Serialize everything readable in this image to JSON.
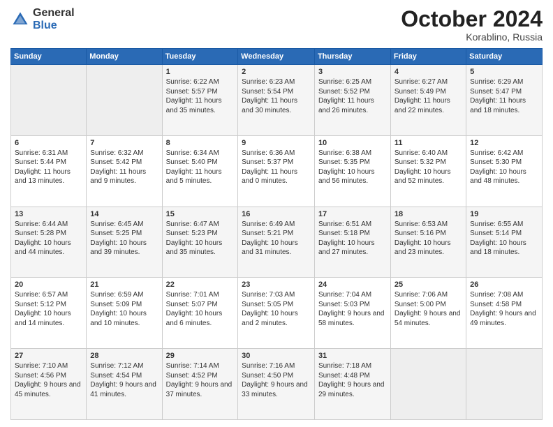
{
  "logo": {
    "general": "General",
    "blue": "Blue"
  },
  "header": {
    "month": "October 2024",
    "location": "Korablino, Russia"
  },
  "weekdays": [
    "Sunday",
    "Monday",
    "Tuesday",
    "Wednesday",
    "Thursday",
    "Friday",
    "Saturday"
  ],
  "weeks": [
    [
      {
        "day": "",
        "sunrise": "",
        "sunset": "",
        "daylight": ""
      },
      {
        "day": "",
        "sunrise": "",
        "sunset": "",
        "daylight": ""
      },
      {
        "day": "1",
        "sunrise": "Sunrise: 6:22 AM",
        "sunset": "Sunset: 5:57 PM",
        "daylight": "Daylight: 11 hours and 35 minutes."
      },
      {
        "day": "2",
        "sunrise": "Sunrise: 6:23 AM",
        "sunset": "Sunset: 5:54 PM",
        "daylight": "Daylight: 11 hours and 30 minutes."
      },
      {
        "day": "3",
        "sunrise": "Sunrise: 6:25 AM",
        "sunset": "Sunset: 5:52 PM",
        "daylight": "Daylight: 11 hours and 26 minutes."
      },
      {
        "day": "4",
        "sunrise": "Sunrise: 6:27 AM",
        "sunset": "Sunset: 5:49 PM",
        "daylight": "Daylight: 11 hours and 22 minutes."
      },
      {
        "day": "5",
        "sunrise": "Sunrise: 6:29 AM",
        "sunset": "Sunset: 5:47 PM",
        "daylight": "Daylight: 11 hours and 18 minutes."
      }
    ],
    [
      {
        "day": "6",
        "sunrise": "Sunrise: 6:31 AM",
        "sunset": "Sunset: 5:44 PM",
        "daylight": "Daylight: 11 hours and 13 minutes."
      },
      {
        "day": "7",
        "sunrise": "Sunrise: 6:32 AM",
        "sunset": "Sunset: 5:42 PM",
        "daylight": "Daylight: 11 hours and 9 minutes."
      },
      {
        "day": "8",
        "sunrise": "Sunrise: 6:34 AM",
        "sunset": "Sunset: 5:40 PM",
        "daylight": "Daylight: 11 hours and 5 minutes."
      },
      {
        "day": "9",
        "sunrise": "Sunrise: 6:36 AM",
        "sunset": "Sunset: 5:37 PM",
        "daylight": "Daylight: 11 hours and 0 minutes."
      },
      {
        "day": "10",
        "sunrise": "Sunrise: 6:38 AM",
        "sunset": "Sunset: 5:35 PM",
        "daylight": "Daylight: 10 hours and 56 minutes."
      },
      {
        "day": "11",
        "sunrise": "Sunrise: 6:40 AM",
        "sunset": "Sunset: 5:32 PM",
        "daylight": "Daylight: 10 hours and 52 minutes."
      },
      {
        "day": "12",
        "sunrise": "Sunrise: 6:42 AM",
        "sunset": "Sunset: 5:30 PM",
        "daylight": "Daylight: 10 hours and 48 minutes."
      }
    ],
    [
      {
        "day": "13",
        "sunrise": "Sunrise: 6:44 AM",
        "sunset": "Sunset: 5:28 PM",
        "daylight": "Daylight: 10 hours and 44 minutes."
      },
      {
        "day": "14",
        "sunrise": "Sunrise: 6:45 AM",
        "sunset": "Sunset: 5:25 PM",
        "daylight": "Daylight: 10 hours and 39 minutes."
      },
      {
        "day": "15",
        "sunrise": "Sunrise: 6:47 AM",
        "sunset": "Sunset: 5:23 PM",
        "daylight": "Daylight: 10 hours and 35 minutes."
      },
      {
        "day": "16",
        "sunrise": "Sunrise: 6:49 AM",
        "sunset": "Sunset: 5:21 PM",
        "daylight": "Daylight: 10 hours and 31 minutes."
      },
      {
        "day": "17",
        "sunrise": "Sunrise: 6:51 AM",
        "sunset": "Sunset: 5:18 PM",
        "daylight": "Daylight: 10 hours and 27 minutes."
      },
      {
        "day": "18",
        "sunrise": "Sunrise: 6:53 AM",
        "sunset": "Sunset: 5:16 PM",
        "daylight": "Daylight: 10 hours and 23 minutes."
      },
      {
        "day": "19",
        "sunrise": "Sunrise: 6:55 AM",
        "sunset": "Sunset: 5:14 PM",
        "daylight": "Daylight: 10 hours and 18 minutes."
      }
    ],
    [
      {
        "day": "20",
        "sunrise": "Sunrise: 6:57 AM",
        "sunset": "Sunset: 5:12 PM",
        "daylight": "Daylight: 10 hours and 14 minutes."
      },
      {
        "day": "21",
        "sunrise": "Sunrise: 6:59 AM",
        "sunset": "Sunset: 5:09 PM",
        "daylight": "Daylight: 10 hours and 10 minutes."
      },
      {
        "day": "22",
        "sunrise": "Sunrise: 7:01 AM",
        "sunset": "Sunset: 5:07 PM",
        "daylight": "Daylight: 10 hours and 6 minutes."
      },
      {
        "day": "23",
        "sunrise": "Sunrise: 7:03 AM",
        "sunset": "Sunset: 5:05 PM",
        "daylight": "Daylight: 10 hours and 2 minutes."
      },
      {
        "day": "24",
        "sunrise": "Sunrise: 7:04 AM",
        "sunset": "Sunset: 5:03 PM",
        "daylight": "Daylight: 9 hours and 58 minutes."
      },
      {
        "day": "25",
        "sunrise": "Sunrise: 7:06 AM",
        "sunset": "Sunset: 5:00 PM",
        "daylight": "Daylight: 9 hours and 54 minutes."
      },
      {
        "day": "26",
        "sunrise": "Sunrise: 7:08 AM",
        "sunset": "Sunset: 4:58 PM",
        "daylight": "Daylight: 9 hours and 49 minutes."
      }
    ],
    [
      {
        "day": "27",
        "sunrise": "Sunrise: 7:10 AM",
        "sunset": "Sunset: 4:56 PM",
        "daylight": "Daylight: 9 hours and 45 minutes."
      },
      {
        "day": "28",
        "sunrise": "Sunrise: 7:12 AM",
        "sunset": "Sunset: 4:54 PM",
        "daylight": "Daylight: 9 hours and 41 minutes."
      },
      {
        "day": "29",
        "sunrise": "Sunrise: 7:14 AM",
        "sunset": "Sunset: 4:52 PM",
        "daylight": "Daylight: 9 hours and 37 minutes."
      },
      {
        "day": "30",
        "sunrise": "Sunrise: 7:16 AM",
        "sunset": "Sunset: 4:50 PM",
        "daylight": "Daylight: 9 hours and 33 minutes."
      },
      {
        "day": "31",
        "sunrise": "Sunrise: 7:18 AM",
        "sunset": "Sunset: 4:48 PM",
        "daylight": "Daylight: 9 hours and 29 minutes."
      },
      {
        "day": "",
        "sunrise": "",
        "sunset": "",
        "daylight": ""
      },
      {
        "day": "",
        "sunrise": "",
        "sunset": "",
        "daylight": ""
      }
    ]
  ]
}
